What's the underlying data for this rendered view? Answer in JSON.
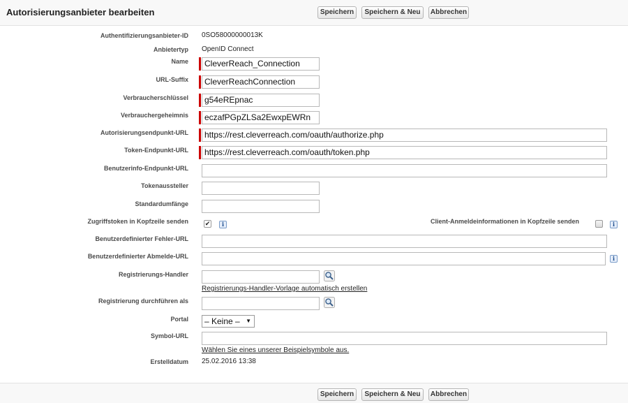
{
  "header": {
    "title": "Autorisierungsanbieter bearbeiten",
    "save": "Speichern",
    "save_new": "Speichern & Neu",
    "cancel": "Abbrechen"
  },
  "fields": {
    "auth_provider_id": {
      "label": "Authentifizierungsanbieter-ID",
      "value": "0SO58000000013K"
    },
    "provider_type": {
      "label": "Anbietertyp",
      "value": "OpenID Connect"
    },
    "name": {
      "label": "Name",
      "value": "CleverReach_Connection"
    },
    "url_suffix": {
      "label": "URL-Suffix",
      "value": "CleverReachConnection"
    },
    "consumer_key": {
      "label": "Verbraucherschlüssel",
      "value": "g54eREpnac"
    },
    "consumer_secret": {
      "label": "Verbrauchergeheimnis",
      "value": "eczafPGpZLSa2EwxpEWRn"
    },
    "authorize_endpoint": {
      "label": "Autorisierungsendpunkt-URL",
      "value": "https://rest.cleverreach.com/oauth/authorize.php"
    },
    "token_endpoint": {
      "label": "Token-Endpunkt-URL",
      "value": "https://rest.cleverreach.com/oauth/token.php"
    },
    "userinfo_endpoint": {
      "label": "Benutzerinfo-Endpunkt-URL",
      "value": ""
    },
    "token_issuer": {
      "label": "Tokenaussteller",
      "value": ""
    },
    "default_scopes": {
      "label": "Standardumfänge",
      "value": ""
    },
    "send_access_token_header": {
      "label": "Zugriffstoken in Kopfzeile senden",
      "checked": true
    },
    "send_client_credentials_header": {
      "label": "Client-Anmeldeinformationen in Kopfzeile senden",
      "checked": false
    },
    "custom_error_url": {
      "label": "Benutzerdefinierter Fehler-URL",
      "value": ""
    },
    "custom_logout_url": {
      "label": "Benutzerdefinierter Abmelde-URL",
      "value": ""
    },
    "registration_handler": {
      "label": "Registrierungs-Handler",
      "value": "",
      "link": "Registrierungs-Handler-Vorlage automatisch erstellen"
    },
    "execute_registration_as": {
      "label": "Registrierung durchführen als",
      "value": ""
    },
    "portal": {
      "label": "Portal",
      "value": "– Keine –"
    },
    "icon_url": {
      "label": "Symbol-URL",
      "value": "",
      "link": "Wählen Sie eines unserer Beispielsymbole aus."
    },
    "created_date": {
      "label": "Erstelldatum",
      "value": "25.02.2016 13:38"
    }
  },
  "icons": {
    "info": "i",
    "checkmark": "✔",
    "dropdown_arrow": "▼"
  }
}
